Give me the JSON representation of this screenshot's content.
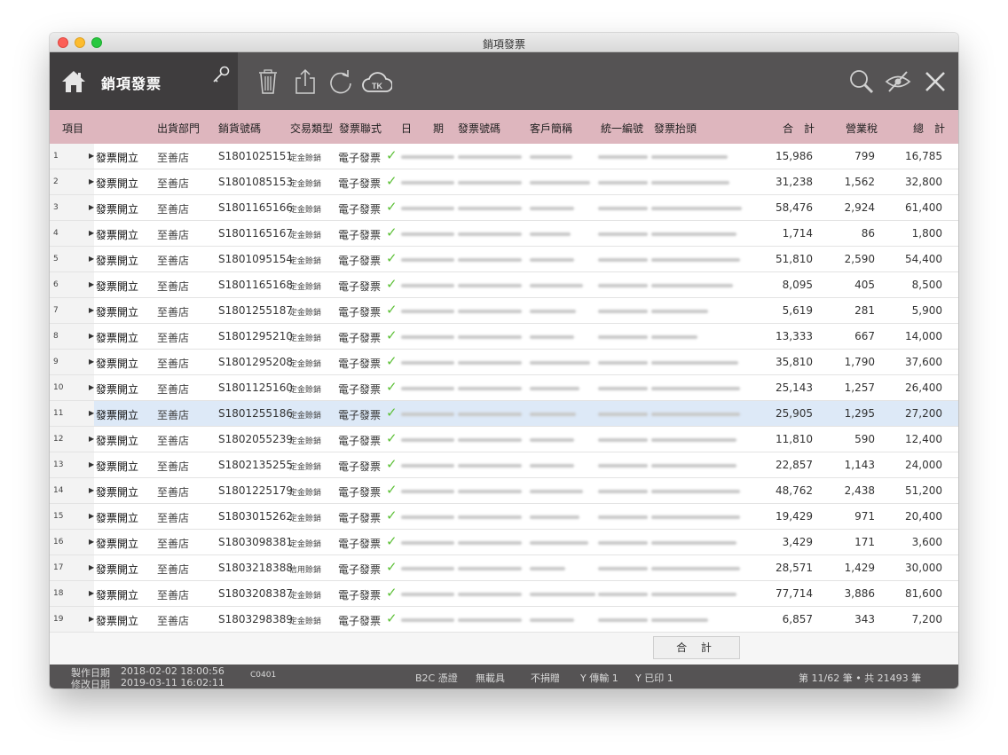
{
  "window": {
    "title": "銷項發票"
  },
  "toolbar": {
    "title": "銷項發票",
    "icons": [
      "home-icon",
      "key-icon",
      "trash-icon",
      "share-icon",
      "refresh-icon",
      "cloud-tk-icon",
      "search-icon",
      "hide-icon",
      "close-icon"
    ],
    "cloud_badge": "TK"
  },
  "columns": {
    "item": "項目",
    "dept": "出貨部門",
    "sales_no": "銷貨號碼",
    "trade_type": "交易類型",
    "invoice_copy": "發票聯式",
    "date": "日　期",
    "invoice_no": "發票號碼",
    "customer": "客戶簡稱",
    "tax_id": "統一編號",
    "invoice_title": "發票抬頭",
    "subtotal": "合　計",
    "tax": "營業稅",
    "total": "總　計"
  },
  "rows": [
    {
      "idx": "1",
      "item": "發票開立",
      "dept": "至善店",
      "sales_no": "S1801025151",
      "trade_type": "定金賒銷",
      "copy": "電子發票",
      "subtotal": "15,986",
      "tax": "799",
      "total": "16,785"
    },
    {
      "idx": "2",
      "item": "發票開立",
      "dept": "至善店",
      "sales_no": "S1801085153",
      "trade_type": "定金賒銷",
      "copy": "電子發票",
      "subtotal": "31,238",
      "tax": "1,562",
      "total": "32,800"
    },
    {
      "idx": "3",
      "item": "發票開立",
      "dept": "至善店",
      "sales_no": "S1801165166",
      "trade_type": "定金賒銷",
      "copy": "電子發票",
      "subtotal": "58,476",
      "tax": "2,924",
      "total": "61,400"
    },
    {
      "idx": "4",
      "item": "發票開立",
      "dept": "至善店",
      "sales_no": "S1801165167",
      "trade_type": "定金賒銷",
      "copy": "電子發票",
      "subtotal": "1,714",
      "tax": "86",
      "total": "1,800"
    },
    {
      "idx": "5",
      "item": "發票開立",
      "dept": "至善店",
      "sales_no": "S1801095154",
      "trade_type": "定金賒銷",
      "copy": "電子發票",
      "subtotal": "51,810",
      "tax": "2,590",
      "total": "54,400"
    },
    {
      "idx": "6",
      "item": "發票開立",
      "dept": "至善店",
      "sales_no": "S1801165168",
      "trade_type": "定金賒銷",
      "copy": "電子發票",
      "subtotal": "8,095",
      "tax": "405",
      "total": "8,500"
    },
    {
      "idx": "7",
      "item": "發票開立",
      "dept": "至善店",
      "sales_no": "S1801255187",
      "trade_type": "定金賒銷",
      "copy": "電子發票",
      "subtotal": "5,619",
      "tax": "281",
      "total": "5,900"
    },
    {
      "idx": "8",
      "item": "發票開立",
      "dept": "至善店",
      "sales_no": "S1801295210",
      "trade_type": "定金賒銷",
      "copy": "電子發票",
      "subtotal": "13,333",
      "tax": "667",
      "total": "14,000"
    },
    {
      "idx": "9",
      "item": "發票開立",
      "dept": "至善店",
      "sales_no": "S1801295208",
      "trade_type": "定金賒銷",
      "copy": "電子發票",
      "subtotal": "35,810",
      "tax": "1,790",
      "total": "37,600"
    },
    {
      "idx": "10",
      "item": "發票開立",
      "dept": "至善店",
      "sales_no": "S1801125160",
      "trade_type": "定金賒銷",
      "copy": "電子發票",
      "subtotal": "25,143",
      "tax": "1,257",
      "total": "26,400"
    },
    {
      "idx": "11",
      "item": "發票開立",
      "dept": "至善店",
      "sales_no": "S1801255186",
      "trade_type": "定金賒銷",
      "copy": "電子發票",
      "subtotal": "25,905",
      "tax": "1,295",
      "total": "27,200",
      "selected": true
    },
    {
      "idx": "12",
      "item": "發票開立",
      "dept": "至善店",
      "sales_no": "S1802055239",
      "trade_type": "定金賒銷",
      "copy": "電子發票",
      "subtotal": "11,810",
      "tax": "590",
      "total": "12,400"
    },
    {
      "idx": "13",
      "item": "發票開立",
      "dept": "至善店",
      "sales_no": "S1802135255",
      "trade_type": "定金賒銷",
      "copy": "電子發票",
      "subtotal": "22,857",
      "tax": "1,143",
      "total": "24,000"
    },
    {
      "idx": "14",
      "item": "發票開立",
      "dept": "至善店",
      "sales_no": "S1801225179",
      "trade_type": "定金賒銷",
      "copy": "電子發票",
      "subtotal": "48,762",
      "tax": "2,438",
      "total": "51,200"
    },
    {
      "idx": "15",
      "item": "發票開立",
      "dept": "至善店",
      "sales_no": "S1803015262",
      "trade_type": "定金賒銷",
      "copy": "電子發票",
      "subtotal": "19,429",
      "tax": "971",
      "total": "20,400"
    },
    {
      "idx": "16",
      "item": "發票開立",
      "dept": "至善店",
      "sales_no": "S1803098381",
      "trade_type": "定金賒銷",
      "copy": "電子發票",
      "subtotal": "3,429",
      "tax": "171",
      "total": "3,600"
    },
    {
      "idx": "17",
      "item": "發票開立",
      "dept": "至善店",
      "sales_no": "S1803218388",
      "trade_type": "信用賒銷",
      "copy": "電子發票",
      "subtotal": "28,571",
      "tax": "1,429",
      "total": "30,000"
    },
    {
      "idx": "18",
      "item": "發票開立",
      "dept": "至善店",
      "sales_no": "S1803208387",
      "trade_type": "定金賒銷",
      "copy": "電子發票",
      "subtotal": "77,714",
      "tax": "3,886",
      "total": "81,600"
    },
    {
      "idx": "19",
      "item": "發票開立",
      "dept": "至善店",
      "sales_no": "S1803298389",
      "trade_type": "定金賒銷",
      "copy": "電子發票",
      "subtotal": "6,857",
      "tax": "343",
      "total": "7,200"
    }
  ],
  "summary": {
    "button_label": "合 計"
  },
  "status": {
    "created_label": "製作日期",
    "created_value": "2018-02-02  18:00:56",
    "modified_label": "修改日期",
    "modified_value": "2019-03-11  16:02:11",
    "code": "C0401",
    "b2c": "B2C 憑證",
    "carrier": "無載具",
    "donate": "不捐贈",
    "transmitted": "Y 傳輸 1",
    "printed": "Y 已印 1",
    "record_info": "第 11/62 筆 • 共 21493 筆"
  },
  "colors": {
    "toolbar": "#555354",
    "header": "#deb6be",
    "check": "#5fc13a",
    "selected_row": "#dde9f7"
  }
}
